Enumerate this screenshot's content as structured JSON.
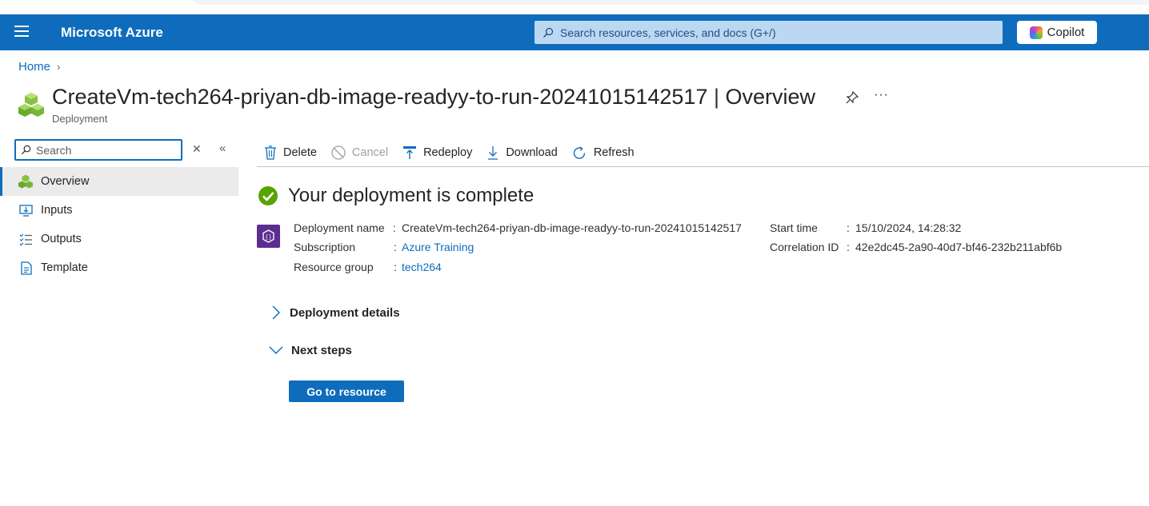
{
  "topbar": {
    "brand": "Microsoft Azure",
    "search_placeholder": "Search resources, services, and docs (G+/)",
    "copilot_label": "Copilot",
    "bg_color": "#0f6cbd"
  },
  "breadcrumb": {
    "items": [
      "Home"
    ]
  },
  "page": {
    "title": "CreateVm-tech264-priyan-db-image-readyy-to-run-20241015142517",
    "section": "Overview",
    "subtitle": "Deployment"
  },
  "sidebar": {
    "search_placeholder": "Search",
    "items": [
      {
        "label": "Overview",
        "icon": "deployment-cubes-icon",
        "active": true
      },
      {
        "label": "Inputs",
        "icon": "monitor-input-icon",
        "active": false
      },
      {
        "label": "Outputs",
        "icon": "list-output-icon",
        "active": false
      },
      {
        "label": "Template",
        "icon": "document-template-icon",
        "active": false
      }
    ]
  },
  "toolbar": {
    "delete": "Delete",
    "cancel": "Cancel",
    "redeploy": "Redeploy",
    "download": "Download",
    "refresh": "Refresh"
  },
  "status": {
    "title": "Your deployment is complete",
    "color": "#57a300"
  },
  "details": {
    "deployment_name_label": "Deployment name",
    "deployment_name": "CreateVm-tech264-priyan-db-image-readyy-to-run-20241015142517",
    "subscription_label": "Subscription",
    "subscription": "Azure Training",
    "resource_group_label": "Resource group",
    "resource_group": "tech264",
    "start_time_label": "Start time",
    "start_time": "15/10/2024, 14:28:32",
    "correlation_id_label": "Correlation ID",
    "correlation_id": "42e2dc45-2a90-40d7-bf46-232b211abf6b"
  },
  "sections": {
    "deployment_details": "Deployment details",
    "next_steps": "Next steps",
    "go_to_resource": "Go to resource"
  }
}
